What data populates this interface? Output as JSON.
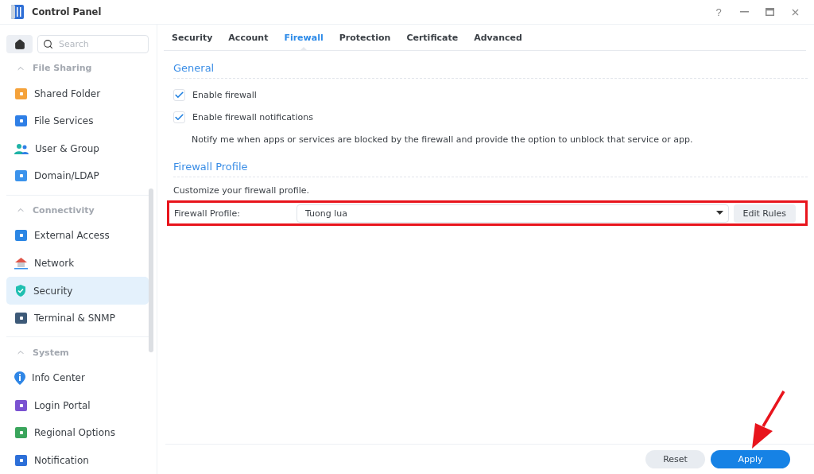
{
  "window": {
    "title": "Control Panel",
    "controls": [
      "?"
    ]
  },
  "sidebar": {
    "search": {
      "placeholder": "Search"
    },
    "groups": [
      {
        "title": "File Sharing",
        "expanded": true,
        "items": [
          {
            "label": "Shared Folder",
            "selected": false
          },
          {
            "label": "File Services",
            "selected": false
          },
          {
            "label": "User & Group",
            "selected": false
          },
          {
            "label": "Domain/LDAP",
            "selected": false
          }
        ]
      },
      {
        "title": "Connectivity",
        "expanded": true,
        "items": [
          {
            "label": "External Access",
            "selected": false
          },
          {
            "label": "Network",
            "selected": false
          },
          {
            "label": "Security",
            "selected": true
          },
          {
            "label": "Terminal & SNMP",
            "selected": false
          }
        ]
      },
      {
        "title": "System",
        "expanded": true,
        "items": [
          {
            "label": "Info Center",
            "selected": false
          },
          {
            "label": "Login Portal",
            "selected": false
          },
          {
            "label": "Regional Options",
            "selected": false
          },
          {
            "label": "Notification",
            "selected": false
          }
        ]
      }
    ]
  },
  "tabs": [
    {
      "label": "Security",
      "selected": false
    },
    {
      "label": "Account",
      "selected": false
    },
    {
      "label": "Firewall",
      "selected": true
    },
    {
      "label": "Protection",
      "selected": false
    },
    {
      "label": "Certificate",
      "selected": false
    },
    {
      "label": "Advanced",
      "selected": false
    }
  ],
  "general": {
    "title": "General",
    "options": [
      {
        "label": "Enable firewall",
        "checked": true
      },
      {
        "label": "Enable firewall notifications",
        "checked": true
      }
    ],
    "note": "Notify me when apps or services are blocked by the firewall and provide the option to unblock that service or app."
  },
  "profile": {
    "title": "Firewall Profile",
    "description": "Customize your firewall profile.",
    "label": "Firewall Profile:",
    "value": "Tuong lua",
    "button": "Edit Rules",
    "highlighted": true
  },
  "footer": {
    "buttons": [
      {
        "label": "Reset",
        "kind": "secondary"
      },
      {
        "label": "Apply",
        "kind": "primary"
      }
    ],
    "arrow": true
  }
}
